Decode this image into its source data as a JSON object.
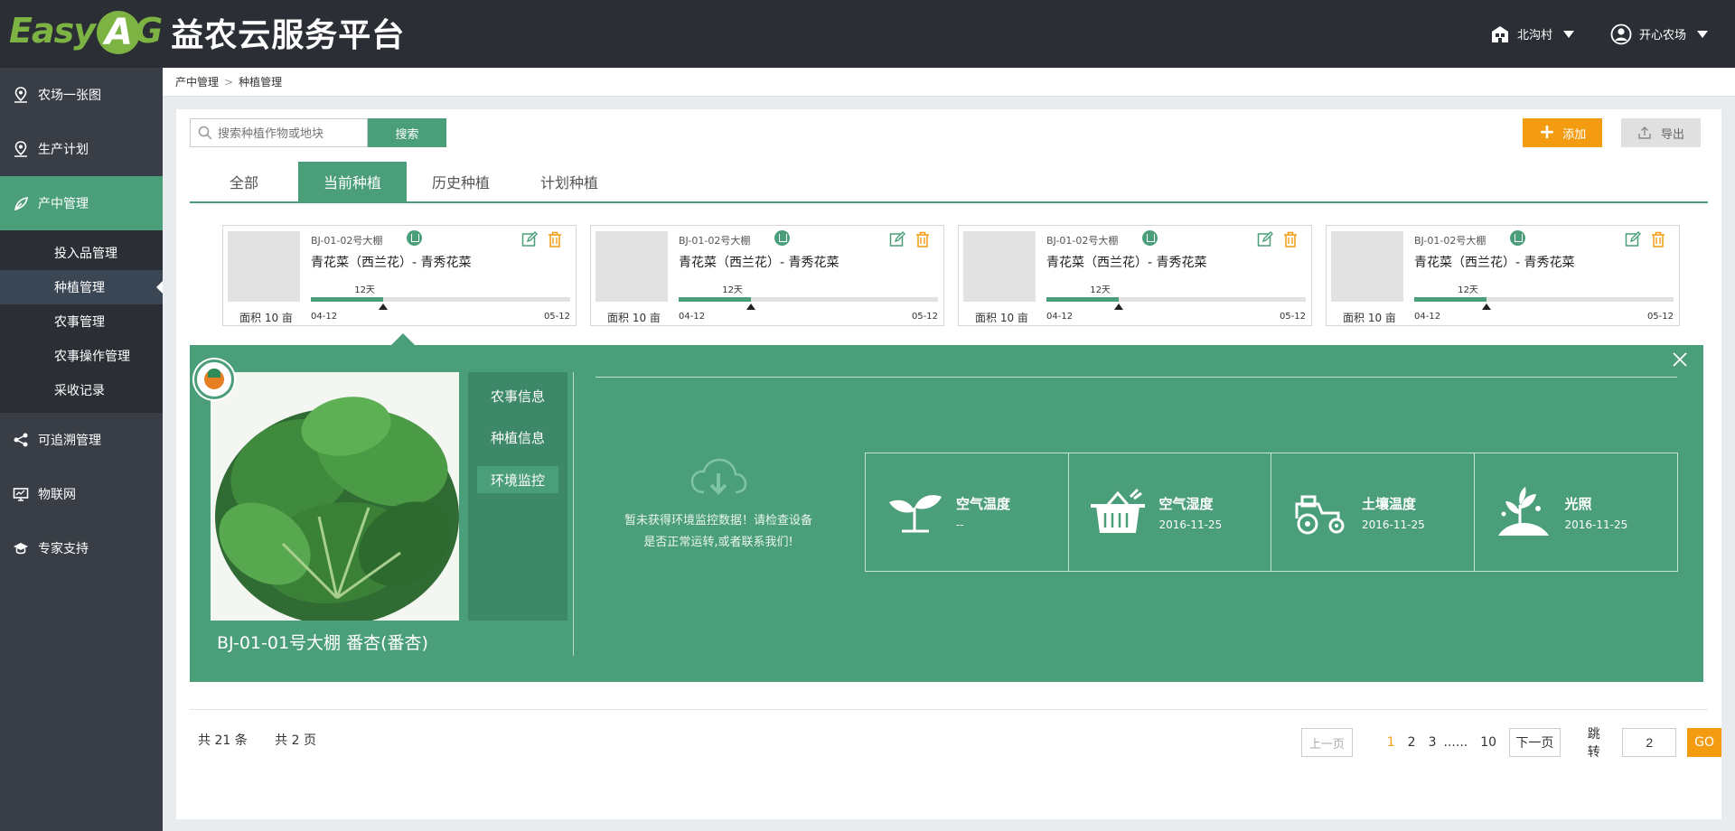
{
  "logo": {
    "brand_mark": "EasyAG",
    "title": "益农云服务平台"
  },
  "header": {
    "village": "北沟村",
    "account": "开心农场"
  },
  "sidebar": {
    "items": [
      {
        "label": "农场一张图",
        "icon": "map-pin-icon"
      },
      {
        "label": "生产计划",
        "icon": "map-pin-icon"
      },
      {
        "label": "产中管理",
        "icon": "leaf-icon",
        "active": true
      },
      {
        "label": "可追溯管理",
        "icon": "share-icon"
      },
      {
        "label": "物联网",
        "icon": "monitor-icon"
      },
      {
        "label": "专家支持",
        "icon": "graduation-cap-icon"
      }
    ],
    "submenu": [
      {
        "label": "投入品管理"
      },
      {
        "label": "种植管理",
        "active": true
      },
      {
        "label": "农事管理"
      },
      {
        "label": "农事操作管理"
      },
      {
        "label": "采收记录"
      }
    ]
  },
  "breadcrumb": {
    "parent": "产中管理",
    "current": "种植管理"
  },
  "toolbar": {
    "search_placeholder": "搜索种植作物或地块",
    "search_label": "搜索",
    "add_label": "添加",
    "export_label": "导出"
  },
  "tabs": [
    "全部",
    "当前种植",
    "历史种植",
    "计划种植"
  ],
  "active_tab": 1,
  "cards": [
    {
      "location": "BJ-01-02号大棚",
      "name": "青花菜（西兰花）- 青秀花菜",
      "area": "面积 10 亩",
      "days": "12天",
      "start": "04-12",
      "end": "05-12",
      "progress": 0.28
    },
    {
      "location": "BJ-01-02号大棚",
      "name": "青花菜（西兰花）- 青秀花菜",
      "area": "面积 10 亩",
      "days": "12天",
      "start": "04-12",
      "end": "05-12",
      "progress": 0.28
    },
    {
      "location": "BJ-01-02号大棚",
      "name": "青花菜（西兰花）- 青秀花菜",
      "area": "面积 10 亩",
      "days": "12天",
      "start": "04-12",
      "end": "05-12",
      "progress": 0.28
    },
    {
      "location": "BJ-01-02号大棚",
      "name": "青花菜（西兰花）- 青秀花菜",
      "area": "面积 10 亩",
      "days": "12天",
      "start": "04-12",
      "end": "05-12",
      "progress": 0.28
    }
  ],
  "detail": {
    "title": "BJ-01-01号大棚 番杏(番杏)",
    "nav": [
      "农事信息",
      "种植信息",
      "环境监控"
    ],
    "active_nav": 2,
    "empty_line1": "暂未获得环境监控数据！请检查设备",
    "empty_line2": "是否正常运转,或者联系我们!",
    "sensors": [
      {
        "label": "空气温度",
        "value": "--",
        "icon": "sprout-icon"
      },
      {
        "label": "空气湿度",
        "value": "2016-11-25",
        "icon": "basket-icon"
      },
      {
        "label": "土壤温度",
        "value": "2016-11-25",
        "icon": "tractor-icon"
      },
      {
        "label": "光照",
        "value": "2016-11-25",
        "icon": "plant-icon"
      }
    ]
  },
  "pagination": {
    "total_items": "共 21 条",
    "total_pages": "共 2 页",
    "prev": "上一页",
    "pages": [
      "1",
      "2",
      "3"
    ],
    "dots": "......",
    "last": "10",
    "current": "1",
    "next": "下一页",
    "jump_label": "跳转",
    "jump_value": "2",
    "go": "GO"
  },
  "colors": {
    "primary": "#4a9e7a",
    "accent": "#f39c12",
    "header_bg": "#2b2f35",
    "sidebar_bg": "#393e46"
  }
}
